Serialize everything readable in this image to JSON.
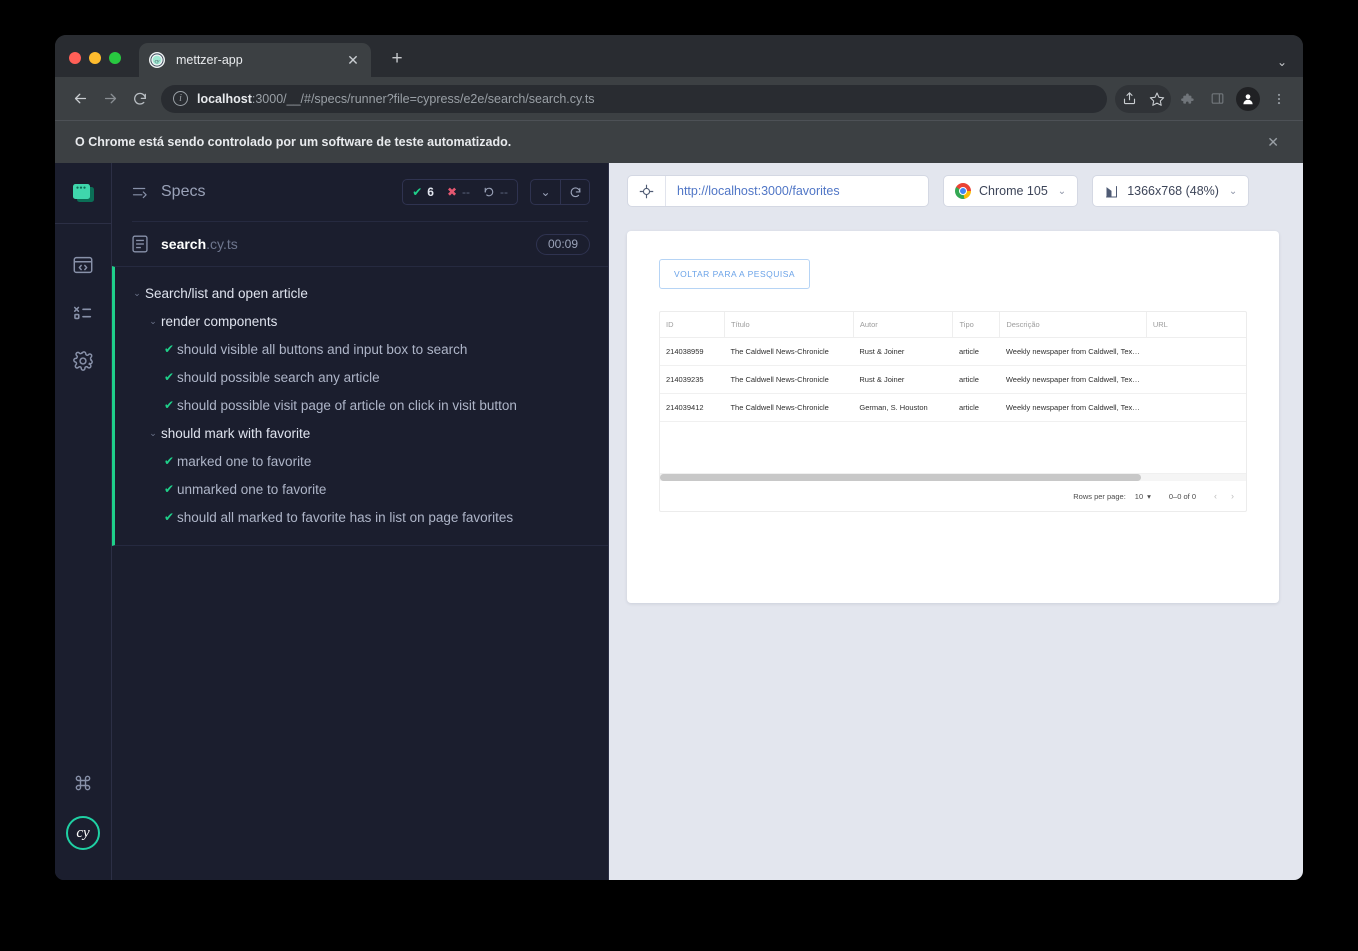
{
  "browser": {
    "tab": {
      "title": "mettzer-app",
      "favicon_icon": "cypress-favicon",
      "close_icon": "close-icon"
    },
    "new_tab_icon": "plus-icon",
    "tab_list_icon": "chevron-down-icon",
    "nav": {
      "back_icon": "arrow-left-icon",
      "forward_icon": "arrow-right-icon",
      "reload_icon": "reload-icon"
    },
    "omnibox": {
      "info_icon": "info-circle-icon",
      "url_host": "localhost",
      "url_rest": ":3000/__/#/specs/runner?file=cypress/e2e/search/search.cy.ts"
    },
    "toolbar_icons": [
      "share-icon",
      "star-icon",
      "extensions-puzzle-icon",
      "side-panel-icon",
      "profile-avatar-icon",
      "kebab-menu-icon"
    ],
    "notice": {
      "text": "O Chrome está sendo controlado por um software de teste automatizado.",
      "close_icon": "close-icon"
    }
  },
  "rail": {
    "logo_icon": "cypress-app-logo",
    "items": [
      {
        "icon": "browser-code-icon",
        "name": "specs"
      },
      {
        "icon": "runs-list-icon",
        "name": "runs"
      },
      {
        "icon": "gear-icon",
        "name": "settings"
      }
    ],
    "bottom": [
      {
        "icon": "command-keyboard-icon",
        "name": "keyboard-shortcuts"
      },
      {
        "icon": "cy-logo-icon",
        "name": "cypress-logo",
        "label": "cy"
      }
    ]
  },
  "specs": {
    "header": {
      "icon": "specs-list-icon",
      "title": "Specs",
      "stats": [
        {
          "icon": "check-icon",
          "kind": "passed",
          "value": "6"
        },
        {
          "icon": "x-icon",
          "kind": "failed",
          "value": "--"
        },
        {
          "icon": "pending-icon",
          "kind": "pending",
          "value": "--"
        }
      ],
      "collapse_icon": "chevron-down-icon",
      "rerun_icon": "reload-icon"
    },
    "file": {
      "icon": "file-icon",
      "name": "search",
      "ext": ".cy.ts",
      "duration": "00:09"
    },
    "tree": [
      {
        "level": 0,
        "type": "suite",
        "label": "Search/list and open article",
        "marker": "chevron-down-icon"
      },
      {
        "level": 1,
        "type": "suite",
        "label": "render components",
        "marker": "chevron-down-icon"
      },
      {
        "level": 2,
        "type": "test",
        "label": "should visible all buttons and input box to search",
        "marker": "check-icon"
      },
      {
        "level": 2,
        "type": "test",
        "label": "should possible search any article",
        "marker": "check-icon"
      },
      {
        "level": 2,
        "type": "test",
        "label": "should possible visit page of article on click in visit button",
        "marker": "check-icon"
      },
      {
        "level": 1,
        "type": "suite",
        "label": "should mark with favorite",
        "marker": "chevron-down-icon"
      },
      {
        "level": 2,
        "type": "test",
        "label": "marked one to favorite",
        "marker": "check-icon"
      },
      {
        "level": 2,
        "type": "test",
        "label": "unmarked one to favorite",
        "marker": "check-icon"
      },
      {
        "level": 2,
        "type": "test",
        "label": "should all marked to favorite has in list on page favorites",
        "marker": "check-icon"
      }
    ]
  },
  "preview": {
    "toolbar": {
      "selector_icon": "selector-playground-icon",
      "url": "http://localhost:3000/favorites",
      "browser_icon": "chrome-logo-icon",
      "browser_label": "Chrome 105",
      "viewport_icon": "viewport-size-icon",
      "viewport_label": "1366x768 (48%)",
      "caret_icon": "chevron-down-icon"
    },
    "app": {
      "back_button": "VOLTAR PARA A PESQUISA",
      "table": {
        "columns": [
          "ID",
          "Título",
          "Autor",
          "Tipo",
          "Descrição",
          "URL"
        ],
        "rows": [
          {
            "id": "214038959",
            "titulo": "The Caldwell News-Chronicle",
            "autor": "Rust & Joiner",
            "tipo": "article",
            "descricao": "Weekly newspaper from Caldwell, Texas t...",
            "url": ""
          },
          {
            "id": "214039235",
            "titulo": "The Caldwell News-Chronicle",
            "autor": "Rust & Joiner",
            "tipo": "article",
            "descricao": "Weekly newspaper from Caldwell, Texas t...",
            "url": ""
          },
          {
            "id": "214039412",
            "titulo": "The Caldwell News-Chronicle",
            "autor": "German, S. Houston",
            "tipo": "article",
            "descricao": "Weekly newspaper from Caldwell, Texas t...",
            "url": ""
          }
        ],
        "footer": {
          "rows_per_page_label": "Rows per page:",
          "rows_per_page_value": "10",
          "range_label": "0–0 of 0",
          "prev_icon": "chevron-left-icon",
          "next_icon": "chevron-right-icon"
        }
      }
    }
  },
  "colors": {
    "cypress_green": "#1fd08a",
    "fail_red": "#e45770",
    "panel_bg": "#1b1e2e",
    "preview_bg": "#e3e6ee",
    "link_blue": "#5076c6"
  }
}
